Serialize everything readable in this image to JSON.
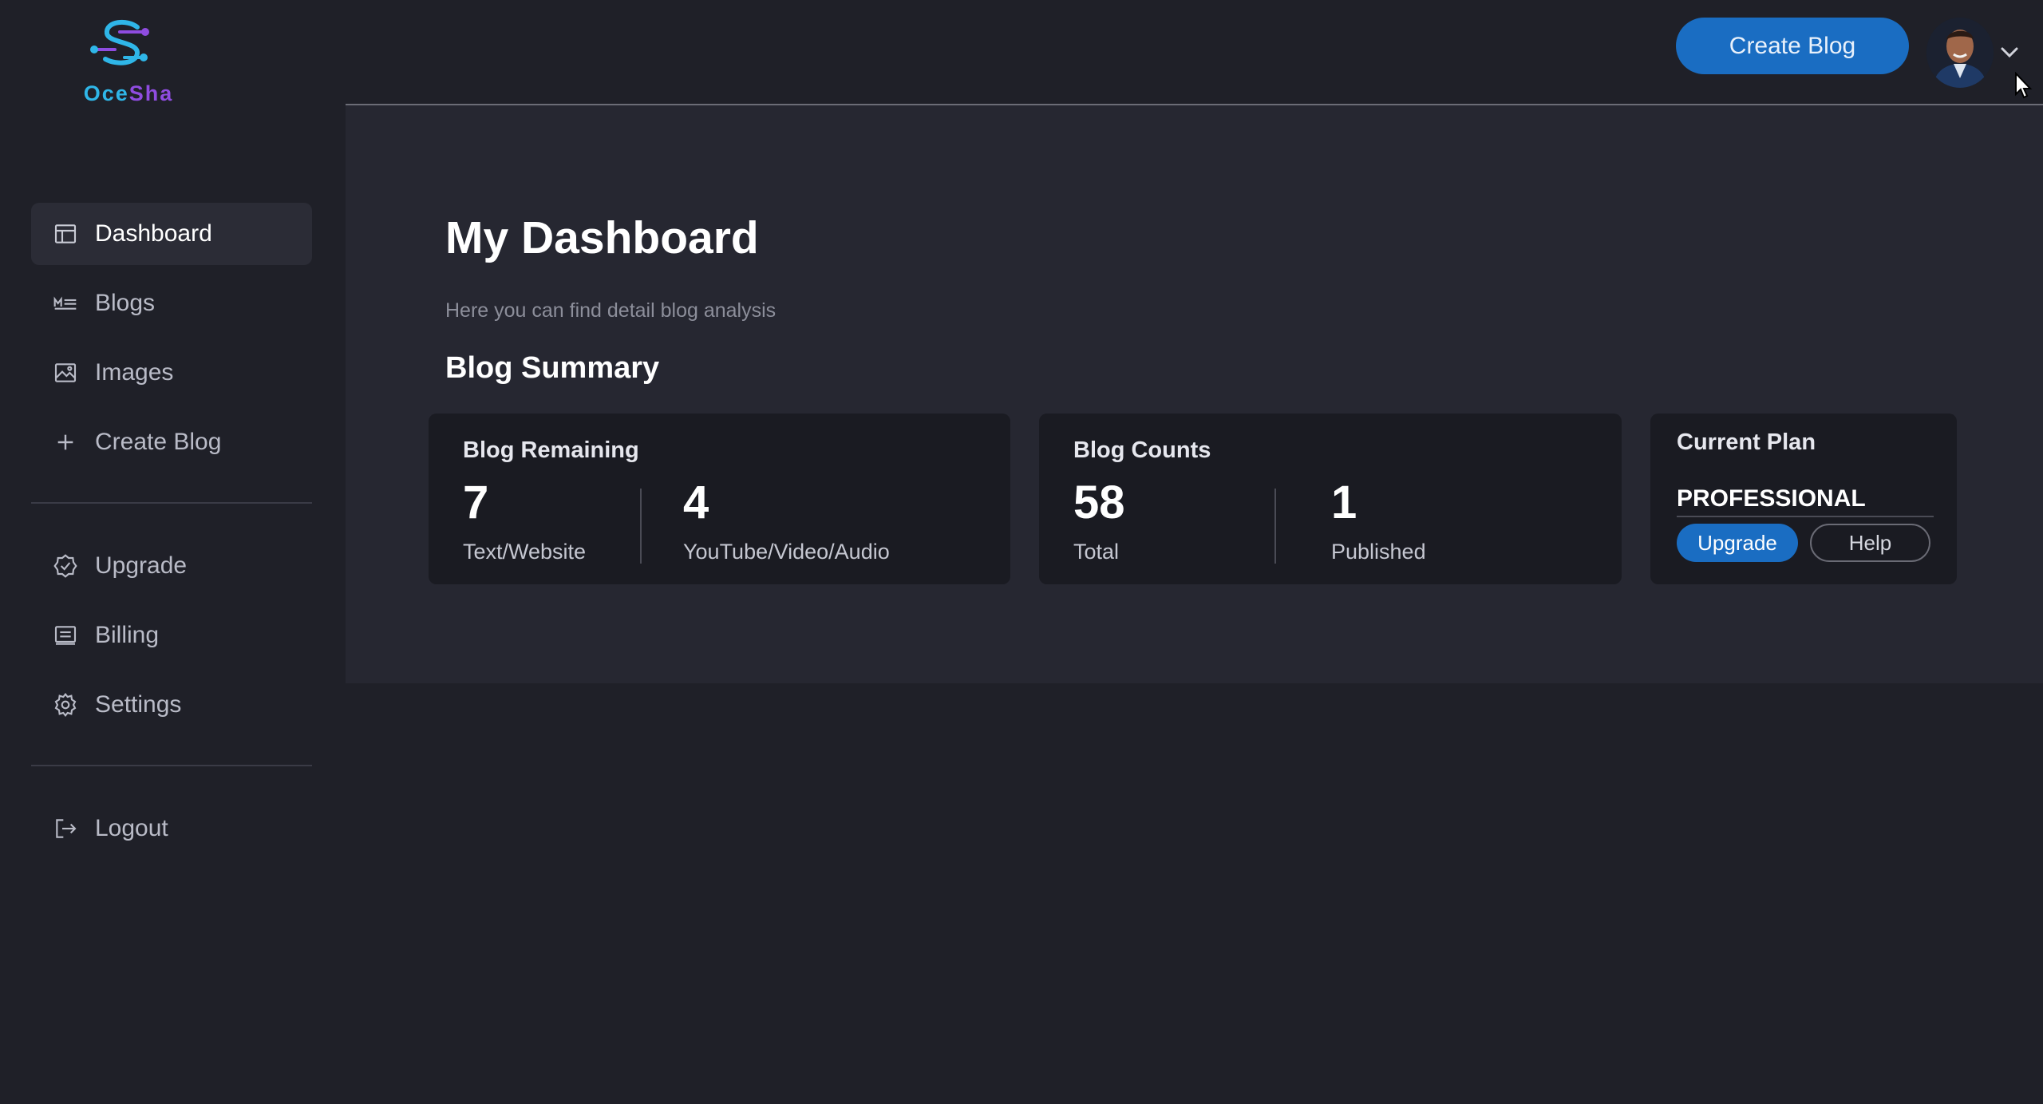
{
  "brand": {
    "logo_part1": "Oce",
    "logo_part2": "Sha"
  },
  "sidebar": {
    "items": [
      {
        "label": "Dashboard",
        "icon": "dashboard-icon",
        "active": true
      },
      {
        "label": "Blogs",
        "icon": "blogs-icon"
      },
      {
        "label": "Images",
        "icon": "image-icon"
      },
      {
        "label": "Create Blog",
        "icon": "plus-icon"
      },
      {
        "label": "Upgrade",
        "icon": "badge-check-icon"
      },
      {
        "label": "Billing",
        "icon": "billing-icon"
      },
      {
        "label": "Settings",
        "icon": "gear-icon"
      },
      {
        "label": "Logout",
        "icon": "logout-icon"
      }
    ]
  },
  "header": {
    "create_button": "Create Blog"
  },
  "main": {
    "title": "My Dashboard",
    "subtitle": "Here you can find detail blog analysis",
    "section_title": "Blog Summary",
    "cards": {
      "remaining": {
        "title": "Blog Remaining",
        "stats": [
          {
            "value": "7",
            "label": "Text/Website"
          },
          {
            "value": "4",
            "label": "YouTube/Video/Audio"
          }
        ]
      },
      "counts": {
        "title": "Blog Counts",
        "stats": [
          {
            "value": "58",
            "label": "Total"
          },
          {
            "value": "1",
            "label": "Published"
          }
        ]
      },
      "plan": {
        "title": "Current Plan",
        "plan_name": "PROFESSIONAL",
        "upgrade_label": "Upgrade",
        "help_label": "Help"
      }
    }
  },
  "colors": {
    "background": "#1f2028",
    "panel": "#262731",
    "card": "#1a1b22",
    "accent": "#1a6dc2",
    "logo_blue": "#2fb6e8",
    "logo_purple": "#8f4ce0"
  }
}
